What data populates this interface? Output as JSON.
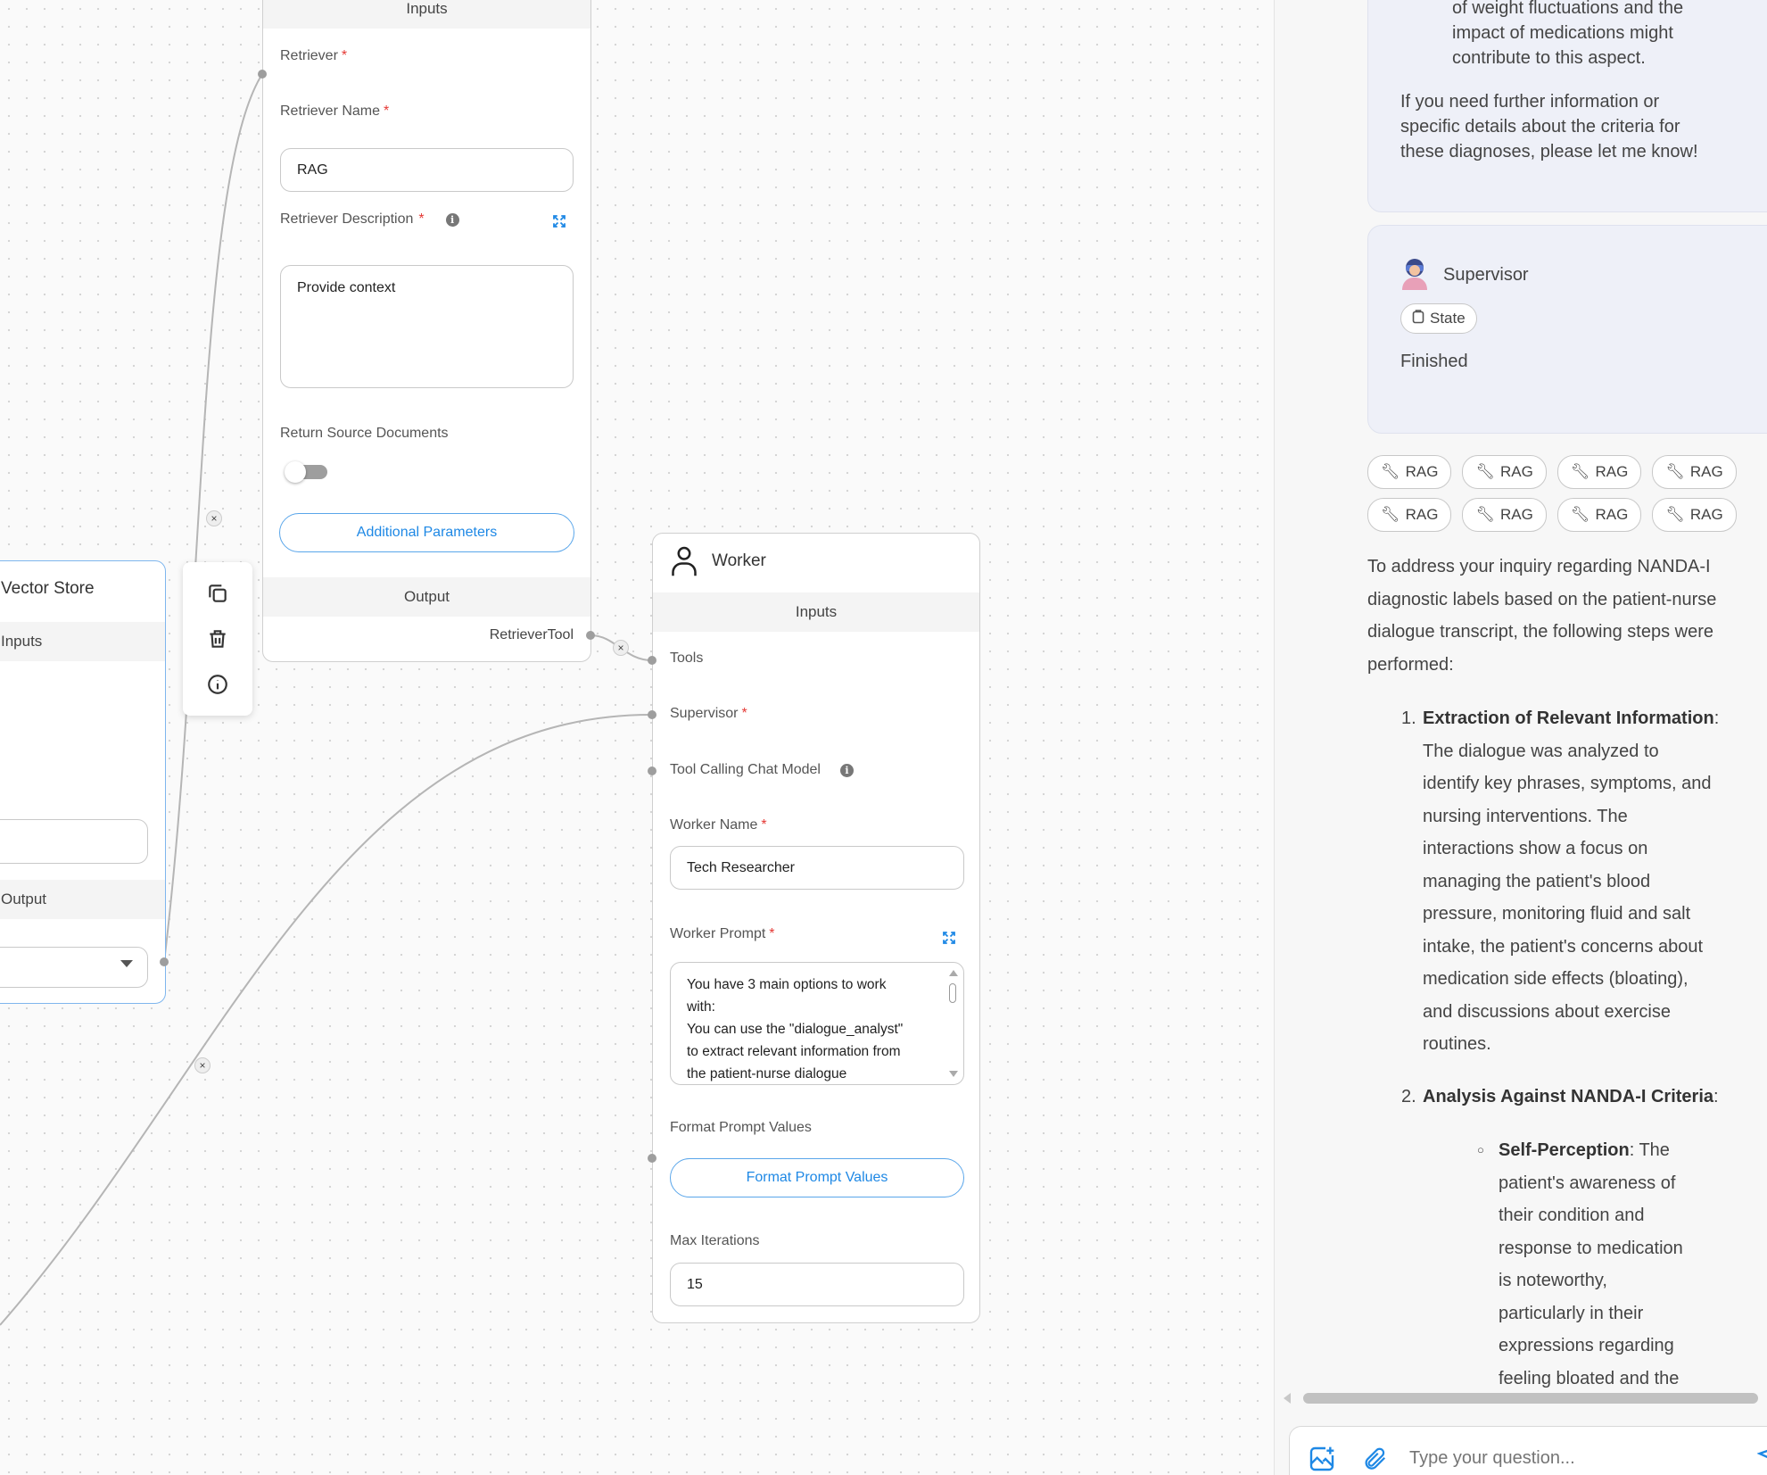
{
  "retriever_node": {
    "inputs_label": "Inputs",
    "retriever_label": "Retriever",
    "retriever_name_label": "Retriever Name",
    "retriever_name_value": "RAG",
    "retriever_description_label": "Retriever Description",
    "retriever_description_value": "Provide context",
    "return_source_label": "Return Source Documents",
    "return_source_enabled": false,
    "additional_params_label": "Additional Parameters",
    "output_label": "Output",
    "output_handle_label": "RetrieverTool"
  },
  "vector_store_node": {
    "title": "Vector Store",
    "inputs_label": "Inputs",
    "output_label": "Output"
  },
  "worker_node": {
    "title": "Worker",
    "inputs_label": "Inputs",
    "tools_label": "Tools",
    "supervisor_label": "Supervisor",
    "chat_model_label": "Tool Calling Chat Model",
    "worker_name_label": "Worker Name",
    "worker_name_value": "Tech Researcher",
    "worker_prompt_label": "Worker Prompt",
    "worker_prompt_lines": [
      "You have 3 main options to work",
      "with:",
      "You can use the \"dialogue_analyst\"",
      "to extract relevant information from",
      "the patient-nurse dialogue"
    ],
    "format_prompt_label": "Format Prompt Values",
    "format_prompt_button": "Format Prompt Values",
    "max_iterations_label": "Max Iterations",
    "max_iterations_value": "15"
  },
  "chat": {
    "prev_message_lines": [
      "of weight fluctuations and the",
      "impact of medications might",
      "contribute to this aspect."
    ],
    "prev_message_closing": [
      "If you need further information or",
      "specific details about the criteria for",
      "these diagnoses, please let me know!"
    ],
    "supervisor_name": "Supervisor",
    "state_chip": "State",
    "status_text": "Finished",
    "tool_chips": [
      "RAG",
      "RAG",
      "RAG",
      "RAG",
      "RAG",
      "RAG",
      "RAG",
      "RAG"
    ],
    "answer_intro_lines": [
      "To address your inquiry regarding NANDA-I",
      "diagnostic labels based on the patient-nurse",
      "dialogue transcript, the following steps were",
      "performed:"
    ],
    "step1_title": "Extraction of Relevant Information",
    "step1_lines": [
      "The dialogue was analyzed to",
      "identify key phrases, symptoms, and",
      "nursing interventions. The",
      "interactions show a focus on",
      "managing the patient's blood",
      "pressure, monitoring fluid and salt",
      "intake, the patient's concerns about",
      "medication side effects (bloating),",
      "and discussions about exercise",
      "routines."
    ],
    "step2_title": "Analysis Against NANDA-I Criteria",
    "sub_title": "Self-Perception",
    "sub_lines": [
      "The",
      "patient's awareness of",
      "their condition and",
      "response to medication",
      "is noteworthy,",
      "particularly in their",
      "expressions regarding",
      "feeling bloated and the"
    ],
    "input_placeholder": "Type your question..."
  },
  "colors": {
    "accent": "#1e88e5",
    "required": "#e53935",
    "card_bg": "#eef0f8"
  }
}
